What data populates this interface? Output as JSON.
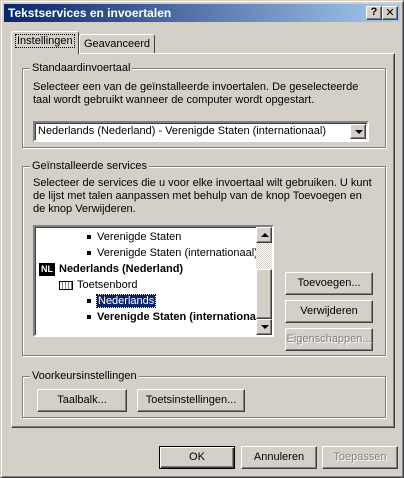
{
  "window": {
    "title": "Tekstservices en invoertalen",
    "help_glyph": "?",
    "close_glyph": "✕"
  },
  "tabs": [
    {
      "label": "Instellingen",
      "active": true
    },
    {
      "label": "Geavanceerd",
      "active": false
    }
  ],
  "default_language": {
    "group_label": "Standaardinvoertaal",
    "description": "Selecteer een van de geïnstalleerde invoertalen. De geselecteerde taal wordt gebruikt wanneer de computer wordt opgestart.",
    "selected": "Nederlands (Nederland) - Verenigde Staten (internationaal)"
  },
  "installed_services": {
    "group_label": "Geïnstalleerde services",
    "description": "Selecteer de services die u voor elke invoertaal wilt gebruiken. U kunt de lijst met talen aanpassen met behulp van de knop Toevoegen en de knop Verwijderen.",
    "tree": {
      "row1": "Verenigde Staten",
      "row2": "Verenigde Staten (internationaal)",
      "lang_badge": "NL",
      "lang_name": "Nederlands (Nederland)",
      "category": "Toetsenbord",
      "row_selected": "Nederlands",
      "row_last": "Verenigde Staten (internationaal)"
    },
    "buttons": {
      "add": "Toevoegen...",
      "remove": "Verwijderen",
      "properties": "Eigenschappen..."
    }
  },
  "preferences": {
    "group_label": "Voorkeursinstellingen",
    "language_bar": "Taalbalk...",
    "key_settings": "Toetsinstellingen..."
  },
  "footer": {
    "ok": "OK",
    "cancel": "Annuleren",
    "apply": "Toepassen"
  },
  "colors": {
    "face": "#d4d0c8",
    "title_start": "#0a246a",
    "title_end": "#a6caf0",
    "selection": "#0a246a"
  }
}
